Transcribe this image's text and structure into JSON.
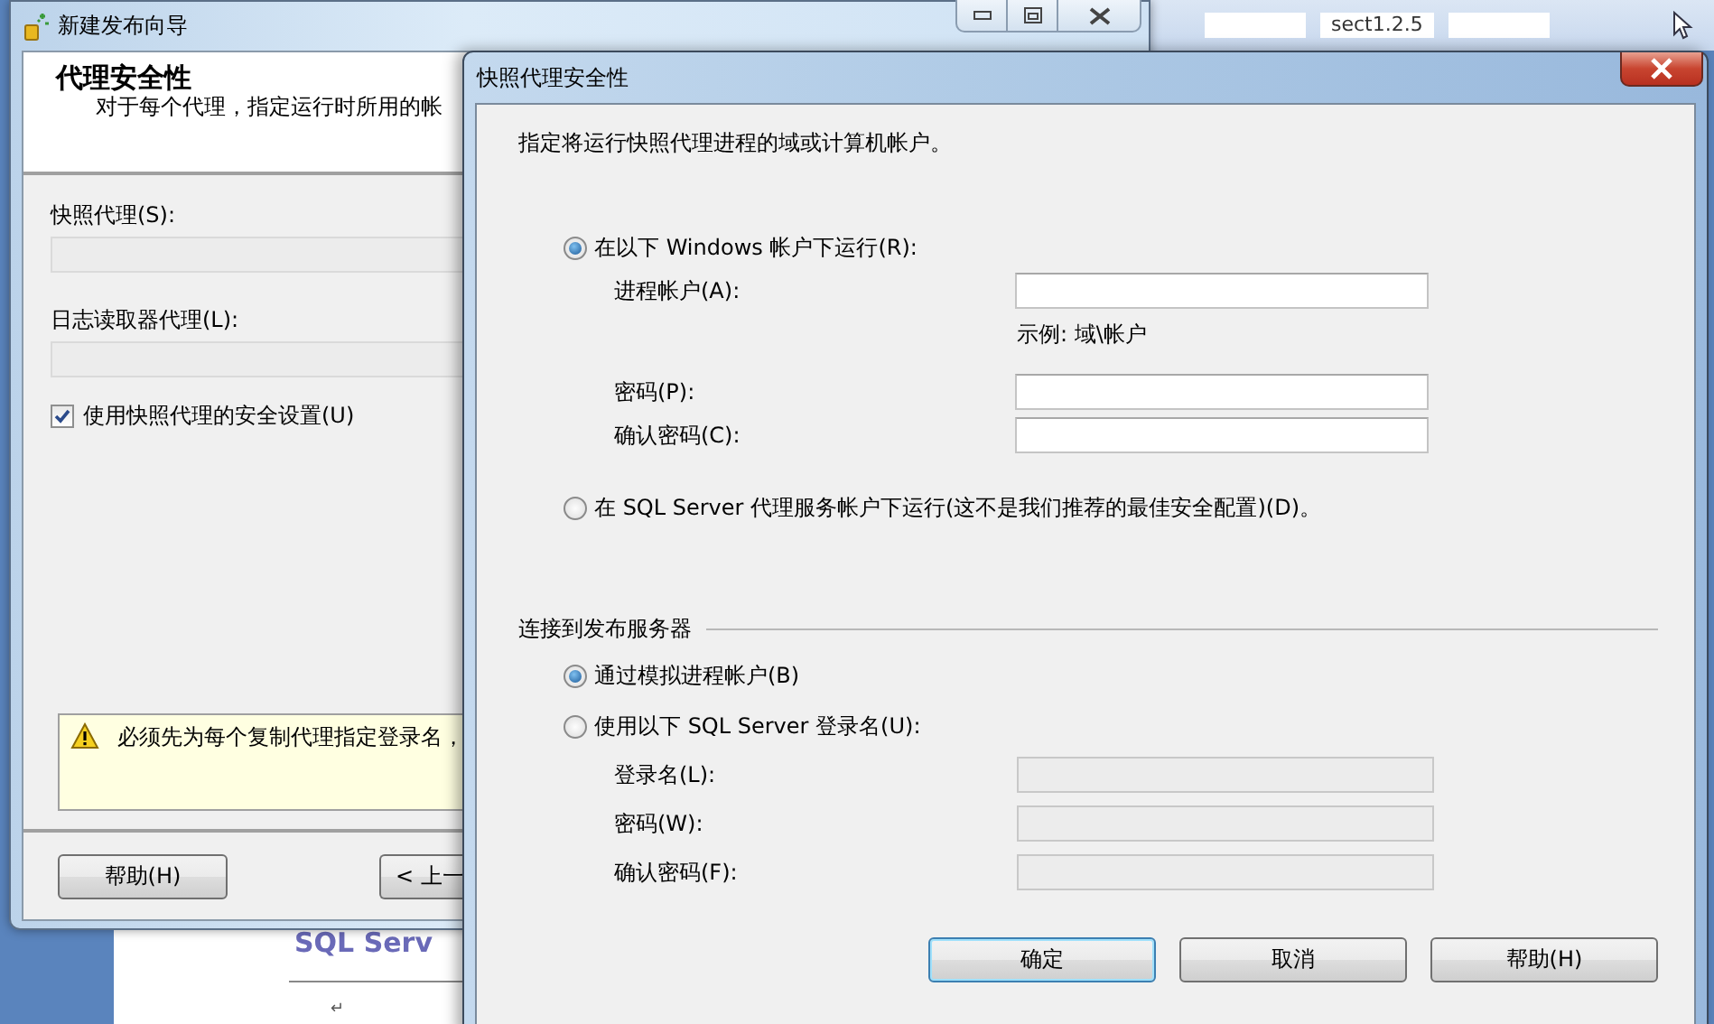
{
  "background": {
    "ribbon_field": "sect1.2.5",
    "document_text": "SQL Serv",
    "paragraph_mark": "↵"
  },
  "wizard": {
    "title": "新建发布向导",
    "heading": "代理安全性",
    "subtitle": "对于每个代理，指定运行时所用的帐",
    "fields": [
      {
        "label": "快照代理(S):",
        "disabled": true
      },
      {
        "label": "日志读取器代理(L):",
        "disabled": true
      }
    ],
    "checkbox": {
      "label": "使用快照代理的安全设置(U)",
      "checked": true
    },
    "warning": "必须先为每个复制代理指定登录名，",
    "buttons": [
      "帮助(H)",
      "< 上一"
    ]
  },
  "dialog": {
    "title": "快照代理安全性",
    "description": "指定将运行快照代理进程的域或计算机帐户。",
    "run_as": [
      {
        "label": "在以下 Windows 帐户下运行(R):",
        "selected": true,
        "fields": [
          {
            "label": "进程帐户(A):",
            "disabled": false,
            "note": "示例: 域\\帐户"
          },
          {
            "label": "密码(P):",
            "disabled": false
          },
          {
            "label": "确认密码(C):",
            "disabled": false
          }
        ]
      },
      {
        "label": "在 SQL Server 代理服务帐户下运行(这不是我们推荐的最佳安全配置)(D)。",
        "selected": false
      }
    ],
    "connect": {
      "heading": "连接到发布服务器",
      "options": [
        {
          "label": "通过模拟进程帐户(B)",
          "selected": true
        },
        {
          "label": "使用以下 SQL Server 登录名(U):",
          "selected": false,
          "fields": [
            {
              "label": "登录名(L):",
              "disabled": true
            },
            {
              "label": "密码(W):",
              "disabled": true
            },
            {
              "label": "确认密码(F):",
              "disabled": true
            }
          ]
        }
      ]
    },
    "buttons": [
      {
        "label": "确定",
        "default": true
      },
      {
        "label": "取消",
        "default": false
      },
      {
        "label": "帮助(H)",
        "default": false
      }
    ]
  }
}
